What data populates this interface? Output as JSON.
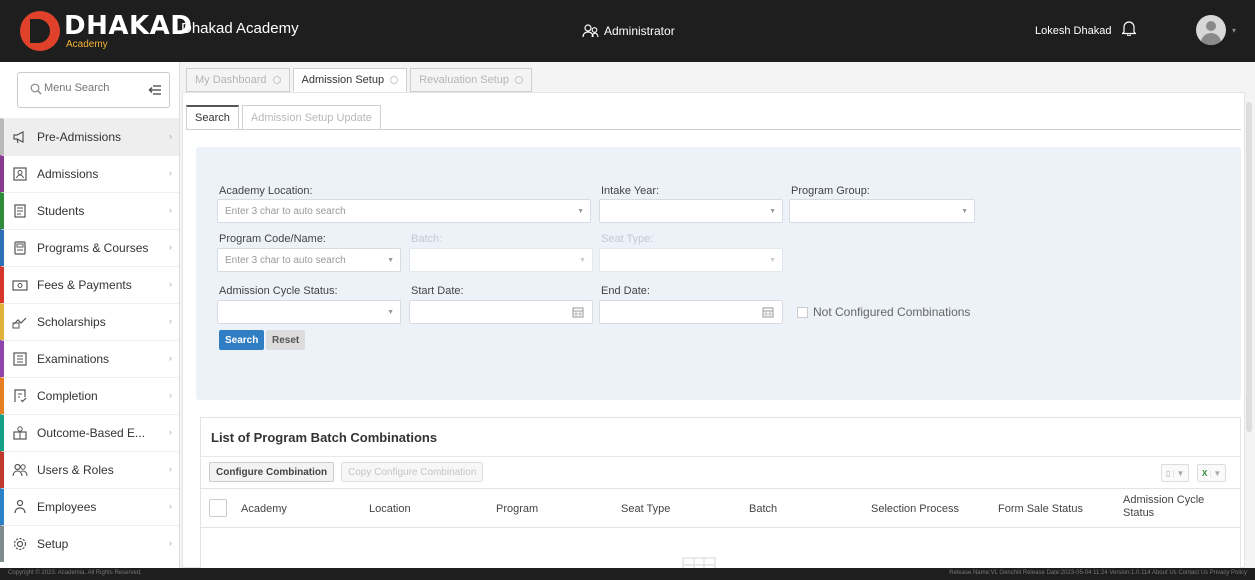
{
  "header": {
    "logo_word": "DHAKAD",
    "logo_sub": "Academy",
    "app_name": "Dhakad Academy",
    "role": "Administrator",
    "user_name": "Lokesh Dhakad"
  },
  "sidebar": {
    "search_placeholder": "Menu Search",
    "items": [
      {
        "label": "Pre-Admissions",
        "icon": "megaphone-icon",
        "accent": "#b9b9b9",
        "active": true
      },
      {
        "label": "Admissions",
        "icon": "admission-icon",
        "accent": "#8a3a8f"
      },
      {
        "label": "Students",
        "icon": "student-icon",
        "accent": "#2e8b3a"
      },
      {
        "label": "Programs & Courses",
        "icon": "program-icon",
        "accent": "#2e6fb5"
      },
      {
        "label": "Fees & Payments",
        "icon": "payment-icon",
        "accent": "#d9362b"
      },
      {
        "label": "Scholarships",
        "icon": "scholarship-icon",
        "accent": "#e2b13c"
      },
      {
        "label": "Examinations",
        "icon": "exam-icon",
        "accent": "#8e44ad"
      },
      {
        "label": "Completion",
        "icon": "completion-icon",
        "accent": "#e67e22"
      },
      {
        "label": "Outcome-Based E...",
        "icon": "outcome-icon",
        "accent": "#16a085"
      },
      {
        "label": "Users & Roles",
        "icon": "users-icon",
        "accent": "#c0392b"
      },
      {
        "label": "Employees",
        "icon": "employees-icon",
        "accent": "#2c82c9"
      },
      {
        "label": "Setup",
        "icon": "setup-icon",
        "accent": "#7f8c8d"
      }
    ]
  },
  "tabs": [
    {
      "label": "My Dashboard",
      "active": false
    },
    {
      "label": "Admission Setup",
      "active": true
    },
    {
      "label": "Revaluation Setup",
      "active": false
    }
  ],
  "subtabs": [
    {
      "label": "Search",
      "active": true
    },
    {
      "label": "Admission Setup Update",
      "active": false
    }
  ],
  "filters": {
    "academy_location": {
      "label": "Academy Location:",
      "placeholder": "Enter 3 char to auto search"
    },
    "intake_year": {
      "label": "Intake Year:",
      "value": ""
    },
    "program_group": {
      "label": "Program Group:",
      "value": ""
    },
    "program_code": {
      "label": "Program Code/Name:",
      "placeholder": "Enter 3 char to auto search"
    },
    "batch": {
      "label": "Batch:",
      "value": ""
    },
    "seat_type": {
      "label": "Seat Type:",
      "value": ""
    },
    "cycle_status": {
      "label": "Admission Cycle Status:",
      "value": ""
    },
    "start_date": {
      "label": "Start Date:",
      "value": ""
    },
    "end_date": {
      "label": "End Date:",
      "value": ""
    },
    "not_configured": "Not Configured Combinations",
    "search_btn": "Search",
    "reset_btn": "Reset"
  },
  "list": {
    "title": "List of Program Batch Combinations",
    "configure_btn": "Configure Combination",
    "copy_btn": "Copy Configure Combination",
    "columns": [
      "Academy",
      "Location",
      "Program",
      "Seat Type",
      "Batch",
      "Selection Process",
      "Form Sale Status",
      "Admission Cycle Status"
    ]
  },
  "footer": {
    "copyright": "Copyright © 2023. Academia. All Rights Reserved.",
    "release": "Release Name:VL Genchill  Release Date:2023-05-04 11:24  Version:1.0.114  About Us  Contact Us  Privacy Policy"
  },
  "colors": {
    "accent": "#2f7ec4",
    "topbar": "#1e1e1e",
    "filter_bg": "#edf1f8"
  }
}
